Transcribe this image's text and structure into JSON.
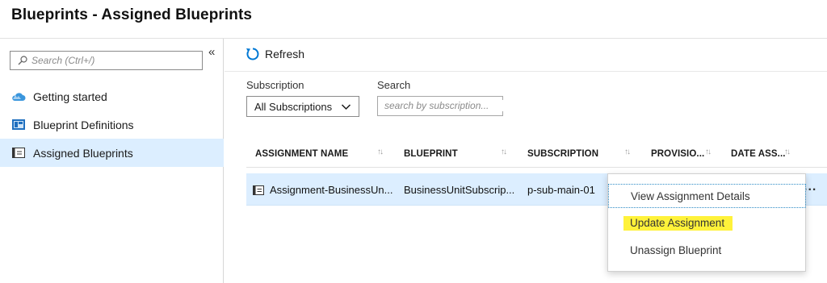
{
  "page": {
    "title": "Blueprints - Assigned Blueprints"
  },
  "sidebar": {
    "search_placeholder": "Search (Ctrl+/)",
    "collapse_glyph": "«",
    "items": [
      {
        "label": "Getting started",
        "icon": "cloud-icon"
      },
      {
        "label": "Blueprint Definitions",
        "icon": "blueprint-definitions-icon"
      },
      {
        "label": "Assigned Blueprints",
        "icon": "assigned-blueprints-icon",
        "selected": true
      }
    ]
  },
  "toolbar": {
    "refresh_label": "Refresh"
  },
  "filters": {
    "subscription_label": "Subscription",
    "subscription_value": "All Subscriptions",
    "search_label": "Search",
    "search_placeholder": "search by subscription..."
  },
  "table": {
    "columns": [
      "ASSIGNMENT NAME",
      "BLUEPRINT",
      "SUBSCRIPTION",
      "PROVISIO...",
      "DATE ASS..."
    ],
    "rows": [
      {
        "assignment_name": "Assignment-BusinessUn...",
        "blueprint": "BusinessUnitSubscrip...",
        "subscription": "p-sub-main-01",
        "more": "..."
      }
    ]
  },
  "context_menu": {
    "items": [
      "View Assignment Details",
      "Update Assignment",
      "Unassign Blueprint"
    ]
  },
  "colors": {
    "accent": "#0078d4",
    "selected_bg": "#dceeff",
    "highlight": "#fff23a"
  }
}
